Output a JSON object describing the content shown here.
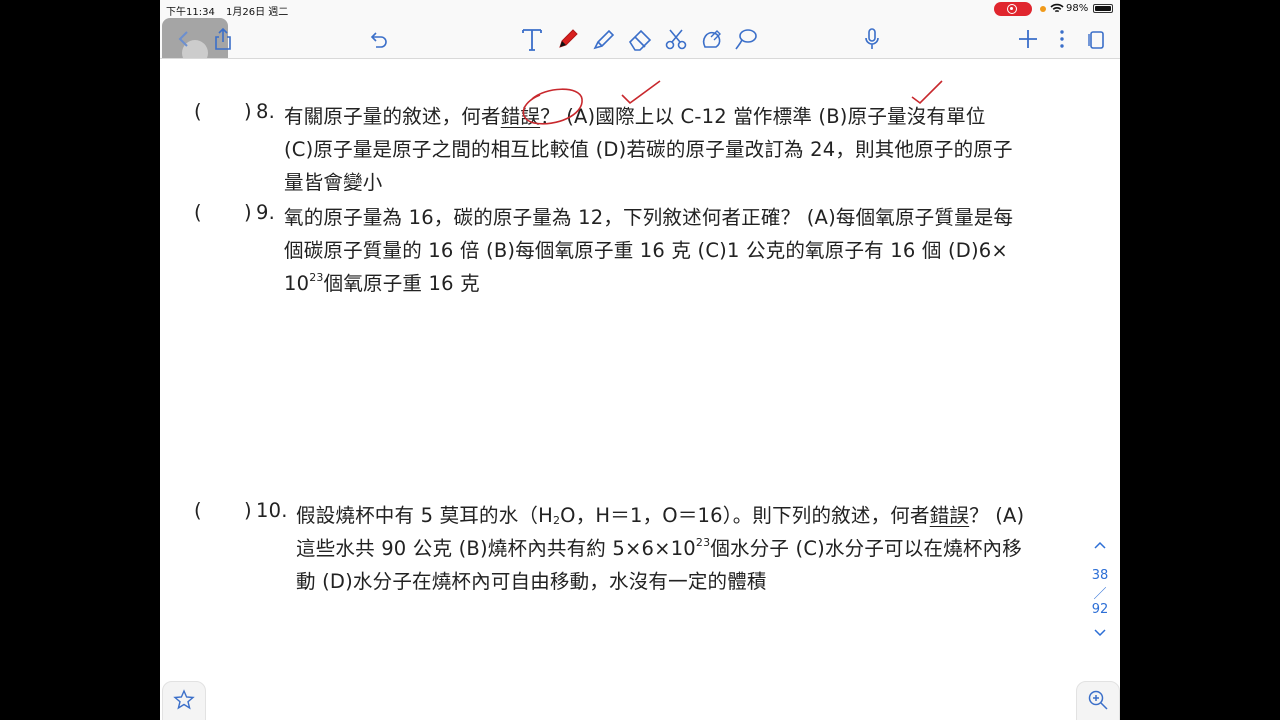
{
  "status_bar": {
    "time": "下午11:34",
    "date": "1月26日 週二",
    "battery": "98%"
  },
  "toolbar": {
    "icons": [
      "back-icon",
      "share-icon",
      "undo-icon",
      "text-tool-icon",
      "pen-icon",
      "highlighter-icon",
      "eraser-icon",
      "scissors-icon",
      "shapes-icon",
      "lasso-icon",
      "microphone-icon",
      "add-icon",
      "more-icon",
      "pages-icon"
    ],
    "accent": "#2d6fd6"
  },
  "questions": [
    {
      "paren_open": "(",
      "paren_close": ")",
      "number": "8.",
      "lines": [
        {
          "pre": "有關原子量的敘述，何者",
          "em": "錯誤",
          "post": "？ (A)國際上以 C-12 當作標準 (B)原子量沒有單位"
        },
        {
          "text": "(C)原子量是原子之間的相互比較值 (D)若碳的原子量改訂為 24，則其他原子的原子"
        },
        {
          "text": "量皆會變小"
        }
      ]
    },
    {
      "paren_open": "(",
      "paren_close": ")",
      "number": "9.",
      "lines": [
        {
          "text": "氧的原子量為 16，碳的原子量為 12，下列敘述何者正確？ (A)每個氧原子質量是每"
        },
        {
          "text": "個碳原子質量的 16 倍 (B)每個氧原子重 16 克 (C)1 公克的氧原子有 16 個 (D)6×"
        },
        {
          "base": "10",
          "exp": "23",
          "post": "個氧原子重 16 克"
        }
      ]
    },
    {
      "paren_open": "(",
      "paren_close": ")",
      "number": "10.",
      "lines": [
        {
          "pre": "假設燒杯中有 5 莫耳的水（H",
          "sub": "2",
          "mid": "O，H＝1，O＝16）。則下列的敘述，何者",
          "em": "錯誤",
          "post": "？ (A)"
        },
        {
          "pre": "這些水共 90 公克 (B)燒杯內共有約 5×6×10",
          "exp": "23",
          "post": "個水分子 (C)水分子可以在燒杯內移"
        },
        {
          "text": "動 (D)水分子在燒杯內可自由移動，水沒有一定的體積"
        }
      ]
    }
  ],
  "pager": {
    "current": "38",
    "separator": "／",
    "total": "92"
  }
}
